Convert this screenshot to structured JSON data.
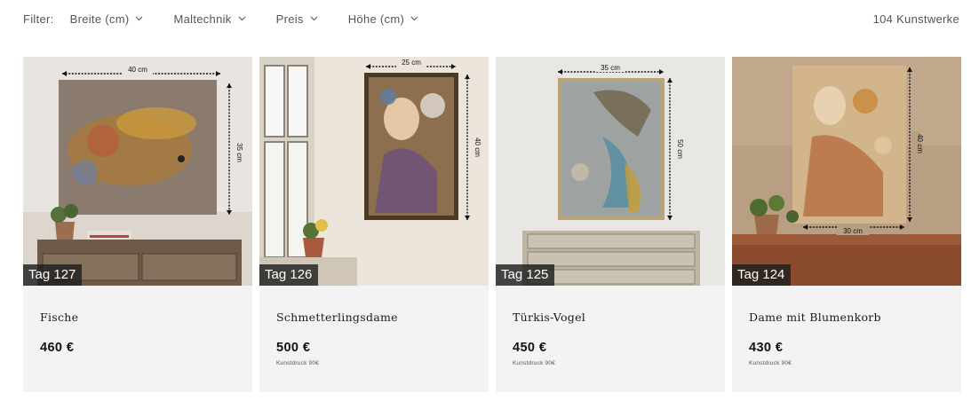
{
  "filters": {
    "label": "Filter:",
    "items": [
      "Breite (cm)",
      "Maltechnik",
      "Preis",
      "Höhe (cm)"
    ],
    "count": "104 Kunstwerke"
  },
  "products": [
    {
      "tag": "Tag 127",
      "title": "Fische",
      "price": "460 €",
      "subline": "",
      "width_label": "40 cm",
      "height_label": "35 cm"
    },
    {
      "tag": "Tag 126",
      "title": "Schmetterlingsdame",
      "price": "500 €",
      "subline": "Kunstdruck 90€",
      "width_label": "25 cm",
      "height_label": "40 cm"
    },
    {
      "tag": "Tag 125",
      "title": "Türkis-Vogel",
      "price": "450 €",
      "subline": "Kunstdruck 90€",
      "width_label": "35 cm",
      "height_label": "50 cm"
    },
    {
      "tag": "Tag 124",
      "title": "Dame mit Blumenkorb",
      "price": "430 €",
      "subline": "Kunstdruck 90€",
      "width_label": "30 cm",
      "height_label": "40 cm"
    }
  ],
  "colors": {
    "card_bg": "#f3f3f3",
    "tag_bg": "#1e1e1e"
  }
}
